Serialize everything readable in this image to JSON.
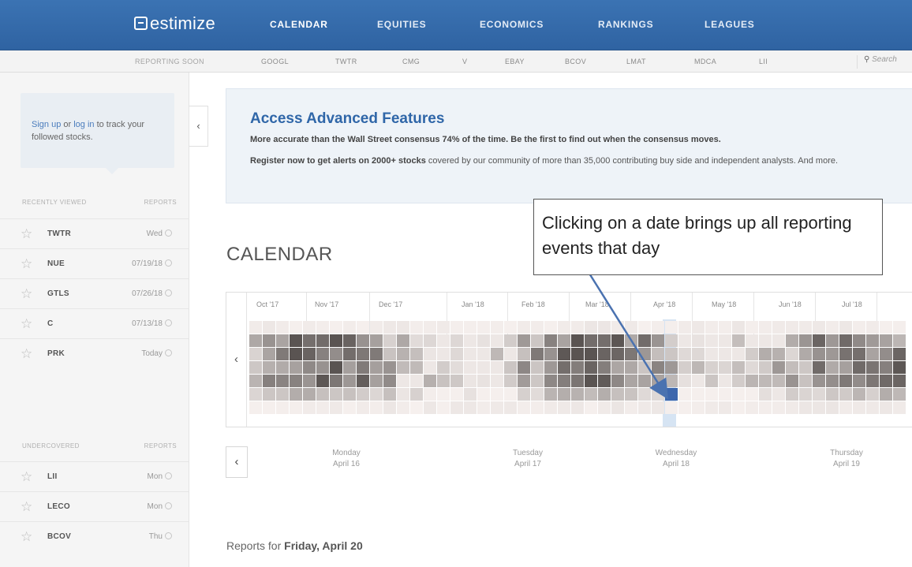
{
  "brand": {
    "logo_text": "estimize"
  },
  "nav": {
    "items": [
      {
        "label": "CALENDAR",
        "active": true
      },
      {
        "label": "EQUITIES",
        "active": false
      },
      {
        "label": "ECONOMICS",
        "active": false
      },
      {
        "label": "RANKINGS",
        "active": false
      },
      {
        "label": "LEAGUES",
        "active": false
      }
    ]
  },
  "ticker_bar": {
    "label": "REPORTING SOON",
    "tickers": [
      "GOOGL",
      "TWTR",
      "CMG",
      "V",
      "EBAY",
      "BCOV",
      "LMAT",
      "MDCA",
      "LII"
    ],
    "search_placeholder": "Search"
  },
  "sidebar": {
    "signin_link_1": "Sign up",
    "signin_or": " or ",
    "signin_link_2": "log in",
    "signin_rest": " to track your followed stocks.",
    "collapse_glyph": "‹",
    "recent": {
      "header_left": "RECENTLY VIEWED",
      "header_right": "REPORTS",
      "rows": [
        {
          "symbol": "TWTR",
          "when": "Wed"
        },
        {
          "symbol": "NUE",
          "when": "07/19/18"
        },
        {
          "symbol": "GTLS",
          "when": "07/26/18"
        },
        {
          "symbol": "C",
          "when": "07/13/18"
        },
        {
          "symbol": "PRK",
          "when": "Today"
        }
      ]
    },
    "undercovered": {
      "header_left": "UNDERCOVERED",
      "header_right": "REPORTS",
      "rows": [
        {
          "symbol": "LII",
          "when": "Mon"
        },
        {
          "symbol": "LECO",
          "when": "Mon"
        },
        {
          "symbol": "BCOV",
          "when": "Thu"
        }
      ]
    }
  },
  "promo": {
    "title": "Access Advanced Features",
    "line1": "More accurate than the Wall Street consensus 74% of the time. Be the first to find out when the consensus moves.",
    "line2_bold": "Register now to get alerts on 2000+ stocks",
    "line2_rest": " covered by our community of more than 35,000 contributing buy side and independent analysts. And more."
  },
  "calendar": {
    "heading": "CALENDAR",
    "prev_glyph": "‹",
    "months": [
      "Oct '17",
      "Nov '17",
      "Dec '17",
      "Jan '18",
      "Feb '18",
      "Mar '18",
      "Apr '18",
      "May '18",
      "Jun '18",
      "Jul '18"
    ],
    "selected_color": "#3d67ad",
    "days": [
      {
        "weekday": "Monday",
        "date": "April 16"
      },
      {
        "weekday": "Tuesday",
        "date": "April 17"
      },
      {
        "weekday": "Wednesday",
        "date": "April 18"
      },
      {
        "weekday": "Thursday",
        "date": "April 19"
      }
    ],
    "reports_prefix": "Reports for ",
    "reports_date": "Friday, April 20"
  },
  "annotation": {
    "text": "Clicking on a date brings up all reporting events that day"
  }
}
